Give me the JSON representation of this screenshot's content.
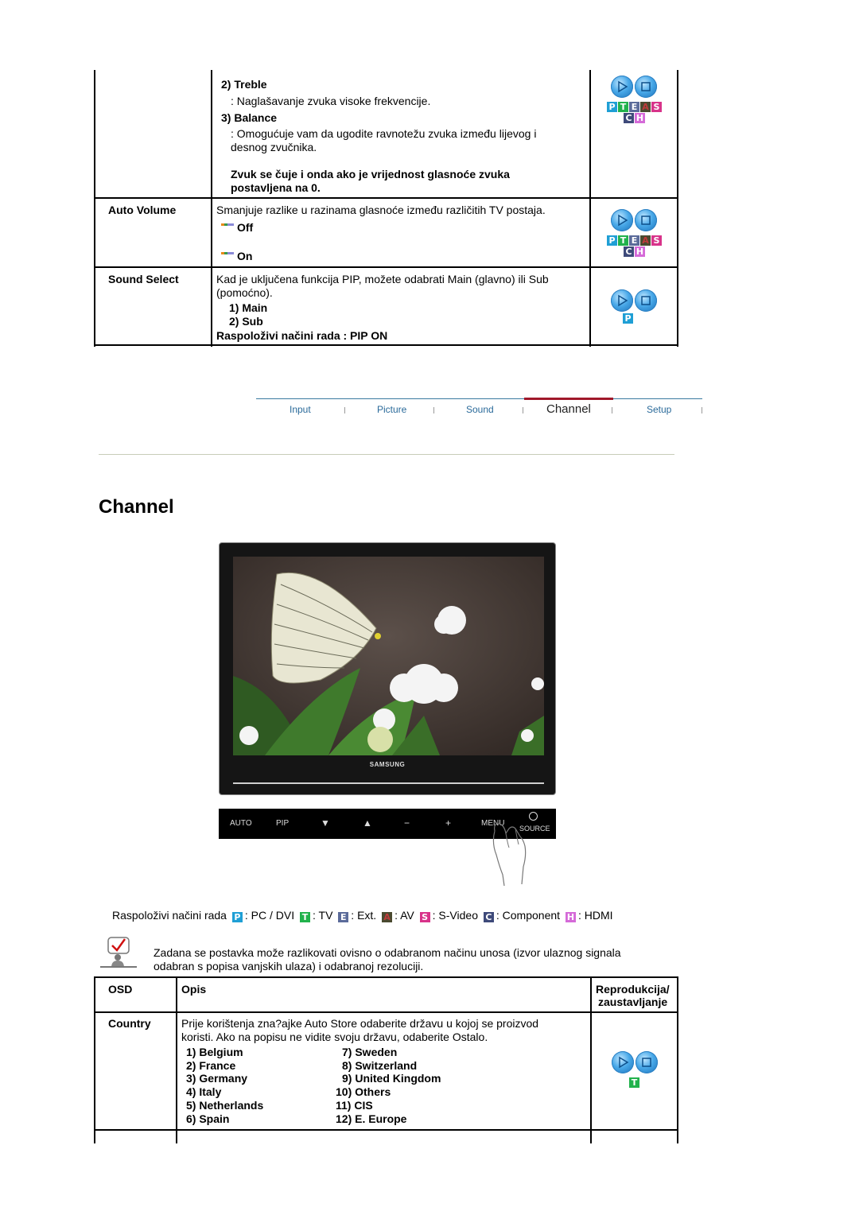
{
  "sound_table": {
    "continued_cell": {
      "items": [
        {
          "label": "2) Treble",
          "desc": ": Naglašavanje zvuka visoke frekvencije."
        },
        {
          "label": "3) Balance",
          "desc_lines": [
            ": Omogućuje vam da ugodite ravnotežu zvuka između lijevog i",
            "desnog zvučnika."
          ]
        }
      ],
      "note_lines": [
        "Zvuk se čuje i onda ako je vrijednost glasnoće zvuka",
        "postavljena na 0."
      ],
      "modes": [
        "P",
        "T",
        "E",
        "A",
        "S",
        "C",
        "H"
      ]
    },
    "rows": [
      {
        "osd": "Auto Volume",
        "desc": "Smanjuje razlike u razinama glasnoće između različitih TV postaja.",
        "options": [
          "Off",
          "On"
        ],
        "modes": [
          "P",
          "T",
          "E",
          "A",
          "S",
          "C",
          "H"
        ]
      },
      {
        "osd": "Sound Select",
        "desc_lines": [
          "Kad je uključena funkcija PIP, možete odabrati Main (glavno) ili Sub",
          "(pomoćno)."
        ],
        "options": [
          "1) Main",
          "2) Sub"
        ],
        "note": "Raspoloživi načini rada : PIP ON",
        "modes": [
          "P"
        ]
      }
    ]
  },
  "nav": {
    "tabs": [
      "Input",
      "Picture",
      "Sound",
      "Channel",
      "Setup"
    ],
    "active": "Channel",
    "active_color": "#a0182a"
  },
  "section": {
    "title": "Channel"
  },
  "monitor": {
    "brand": "SAMSUNG",
    "panel_buttons": [
      "AUTO",
      "PIP",
      "▼",
      "▲",
      "−",
      "+",
      "MENU",
      "SOURCE"
    ]
  },
  "legend": {
    "prefix": "Raspoloživi načini rada",
    "items": [
      {
        "code": "P",
        "label": ": PC / DVI"
      },
      {
        "code": "T",
        "label": ": TV"
      },
      {
        "code": "E",
        "label": ": Ext."
      },
      {
        "code": "A",
        "label": ": AV"
      },
      {
        "code": "S",
        "label": ": S-Video"
      },
      {
        "code": "C",
        "label": ": Component"
      },
      {
        "code": "H",
        "label": ": HDMI"
      }
    ]
  },
  "notice": {
    "lines": [
      "Zadana se postavka može razlikovati ovisno o odabranom načinu unosa (izvor ulaznog signala",
      "odabran s popisa vanjskih ulaza) i odabranoj rezoluciji."
    ]
  },
  "channel_table": {
    "headers": {
      "osd": "OSD",
      "desc": "Opis",
      "play_lines": [
        "Reprodukcija/",
        "zaustavljanje"
      ]
    },
    "rows": [
      {
        "osd": "Country",
        "desc_lines": [
          "Prije korištenja zna?ajke Auto Store odaberite državu u kojoj se proizvod",
          "koristi. Ako na popisu ne vidite svoju državu, odaberite Ostalo."
        ],
        "countries_left": [
          "1) Belgium",
          "2) France",
          "3) Germany",
          "4) Italy",
          "5) Netherlands",
          "6) Spain"
        ],
        "countries_right": [
          "7) Sweden",
          "8) Switzerland",
          "9) United Kingdom",
          "10) Others",
          "11) CIS",
          "12) E. Europe"
        ],
        "modes": [
          "T"
        ]
      }
    ]
  }
}
